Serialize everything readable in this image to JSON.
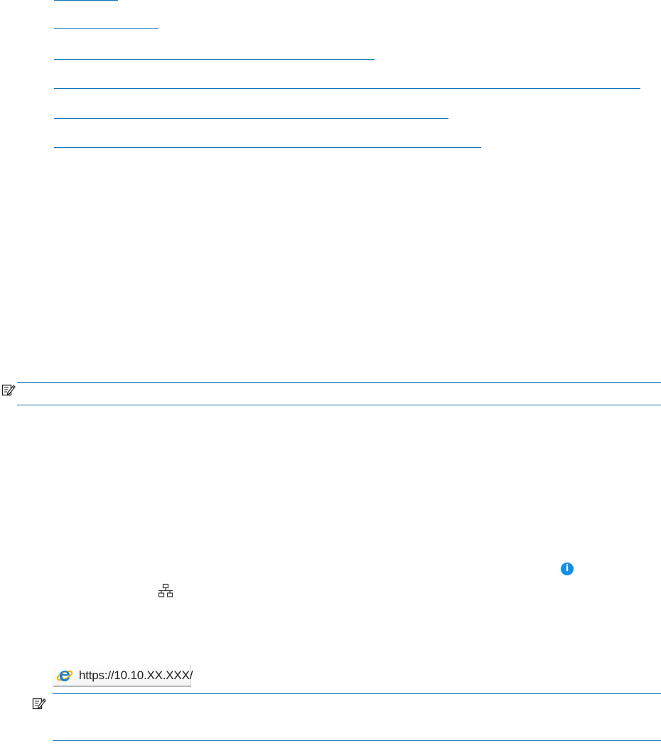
{
  "toc_links": [
    {
      "name": "toc-link-1"
    },
    {
      "name": "toc-link-2"
    },
    {
      "name": "toc-link-3"
    },
    {
      "name": "toc-link-4"
    },
    {
      "name": "toc-link-5"
    },
    {
      "name": "toc-link-6"
    }
  ],
  "note_1": {
    "icon": "note-pencil-icon"
  },
  "note_2": {
    "icon": "note-pencil-icon"
  },
  "icons": {
    "info": "info-icon",
    "info_glyph": "i",
    "network": "network-icon"
  },
  "address_bar": {
    "browser_icon": "internet-explorer-icon",
    "url": "https://10.10.XX.XXX/"
  },
  "colors": {
    "link": "#0f72b5",
    "info_icon": "#0f8fe8"
  }
}
